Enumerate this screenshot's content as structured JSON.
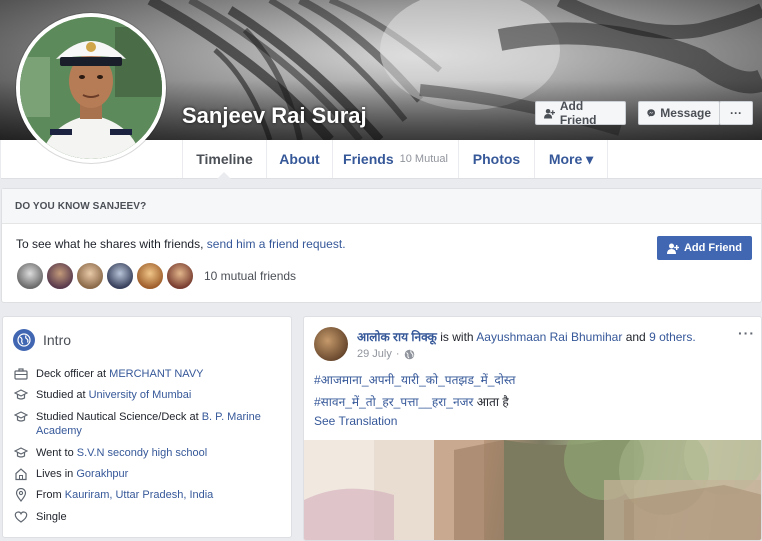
{
  "profile": {
    "name": "Sanjeev Rai Suraj",
    "buttons": {
      "add_friend": "Add Friend",
      "message": "Message",
      "more": "···"
    }
  },
  "nav": {
    "tabs": [
      {
        "label": "Timeline",
        "active": true
      },
      {
        "label": "About"
      },
      {
        "label": "Friends",
        "sub": "10 Mutual"
      },
      {
        "label": "Photos"
      },
      {
        "label": "More ▾"
      }
    ]
  },
  "know": {
    "header": "DO YOU KNOW SANJEEV?",
    "text_prefix": "To see what he shares with friends,",
    "link": "send him a friend request.",
    "add_button": "Add Friend",
    "mutual_count": "10 mutual friends"
  },
  "intro": {
    "title": "Intro",
    "rows": [
      {
        "icon": "briefcase-icon",
        "prefix": "Deck officer at ",
        "link": "MERCHANT NAVY"
      },
      {
        "icon": "graduation-cap-icon",
        "prefix": "Studied at ",
        "link": "University of Mumbai"
      },
      {
        "icon": "graduation-cap-icon",
        "prefix": "Studied Nautical Science/Deck at ",
        "link": "B. P. Marine Academy"
      },
      {
        "icon": "graduation-cap-icon",
        "prefix": "Went to ",
        "link": "S.V.N secondy high school"
      },
      {
        "icon": "home-icon",
        "prefix": "Lives in ",
        "link": "Gorakhpur"
      },
      {
        "icon": "location-pin-icon",
        "prefix": "From ",
        "link": "Kauriram, Uttar Pradesh, India"
      },
      {
        "icon": "heart-icon",
        "prefix": "Single",
        "link": ""
      }
    ]
  },
  "post": {
    "author": "आलोक राय निक्कू",
    "with_text": "is with",
    "with_name": "Aayushmaan Rai Bhumihar",
    "and_text": "and",
    "others": "9 others.",
    "date": "29 July",
    "dot": "·",
    "more": "···",
    "line1_tag": "#आजमाना_अपनी_यारी_को_पतझड_में_दोस्त",
    "line2_tag": "#सावन_में_तो_हर_पत्ता__हरा_नजर",
    "line2_rest": " आता है",
    "see_translation": "See Translation"
  },
  "colors": {
    "facebook_blue": "#4267b2",
    "link_blue": "#365899",
    "background": "#e9ebee"
  }
}
